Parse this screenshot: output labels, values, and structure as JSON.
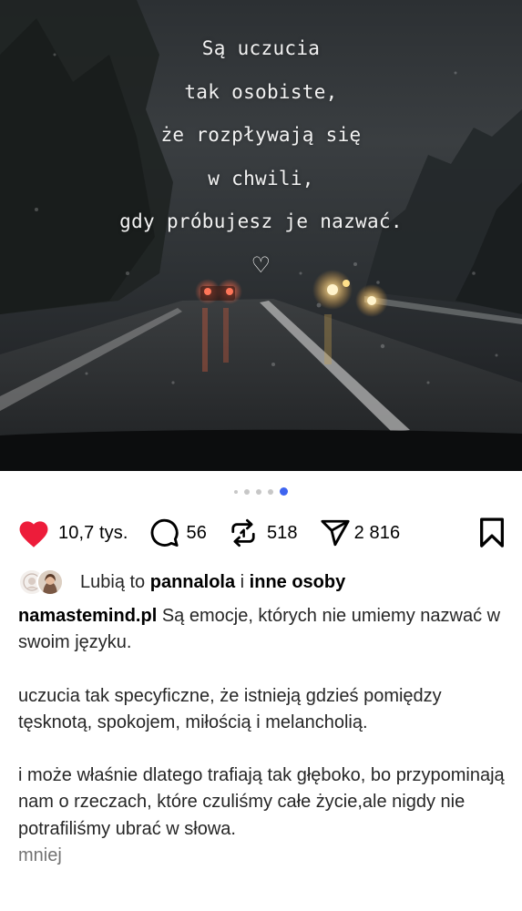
{
  "post": {
    "image": {
      "quote_lines": [
        "Są uczucia",
        "tak osobiste,",
        "że rozpływają się",
        "w chwili,",
        "gdy próbujesz je nazwać."
      ],
      "quote_heart": "♡"
    },
    "carousel": {
      "total_dots": 5,
      "active_index": 4
    },
    "actions": {
      "likes_count": "10,7 tys.",
      "comments_count": "56",
      "reposts_count": "518",
      "shares_count": "2 816",
      "like_color": "#ed1c3a"
    },
    "liked_by": {
      "prefix": "Lubią to",
      "user": "pannalola",
      "connector": "i",
      "others": "inne osoby"
    },
    "caption": {
      "username": "namastemind.pl",
      "paragraph_1": "Są emocje, których nie umiemy nazwać w swoim języku.",
      "paragraph_2": "uczucia tak specyficzne, że istnieją gdzieś pomiędzy tęsknotą, spokojem, miłością i melancholią.",
      "paragraph_3": "i może właśnie dlatego trafiają tak głęboko, bo przypominają nam o rzeczach, które czuliśmy całe życie,ale nigdy nie potrafiliśmy ubrać w słowa.",
      "less_label": "mniej"
    },
    "accent_color": "#3e64f0"
  }
}
